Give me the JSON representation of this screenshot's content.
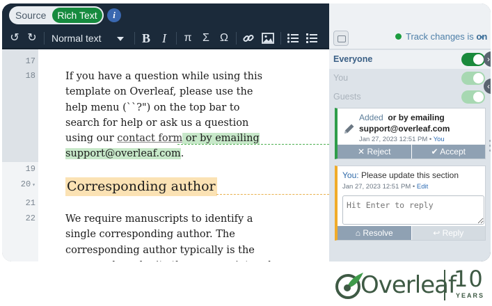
{
  "mode": {
    "source_label": "Source",
    "rich_label": "Rich Text",
    "info_icon": "i"
  },
  "toolbar": {
    "undo_icon": "↺",
    "redo_icon": "↻",
    "style_value": "Normal text",
    "bold_icon": "B",
    "italic_icon": "I",
    "pi_icon": "π",
    "sigma_icon": "Σ",
    "omega_icon": "Ω",
    "link_icon": "link-icon",
    "image_icon": "image-icon",
    "bullet_list_icon": "bullet-list-icon",
    "numbered_list_icon": "numbered-list-icon"
  },
  "editor": {
    "line_numbers": [
      "17",
      "18",
      "19",
      "20",
      "21",
      "22"
    ],
    "para1_text": "If you have a question while using this template on Overleaf, please use the help menu (``?\") on the top bar to search for help or ask us a question using our ",
    "para1_link": "contact form",
    "para1_added": " or by emailing support@overleaf.com",
    "para1_end": ".",
    "heading": "Corresponding author",
    "para2_text": "We require manuscripts to identify a single corresponding author. The corresponding author typically is the person who submits the manuscript and"
  },
  "review": {
    "track_label": "Track changes is ",
    "track_state": "on",
    "toggles": [
      {
        "label": "Everyone",
        "on": true
      },
      {
        "label": "You",
        "on": true
      },
      {
        "label": "Guests",
        "on": true
      }
    ],
    "change": {
      "kind": "Added",
      "text_bold": "or by emailing",
      "text_line2": "support@overleaf.com",
      "date": "Jan 27, 2023 12:51 PM",
      "author": "You",
      "reject_label": "Reject",
      "accept_label": "Accept"
    },
    "comment": {
      "author": "You:",
      "text": "Please update this section",
      "date": "Jan 27, 2023 12:51 PM",
      "edit_label": "Edit",
      "reply_placeholder": "Hit Enter to reply",
      "resolve_label": "Resolve",
      "reply_label": "Reply"
    }
  },
  "logo": {
    "word": "Overleaf",
    "ten": "10",
    "years": "YEARS"
  },
  "colors": {
    "accent_green": "#168a3e",
    "added_bg": "#c7e8c9",
    "comment_bg": "#fbe2b4",
    "navy": "#1b2a3a"
  }
}
